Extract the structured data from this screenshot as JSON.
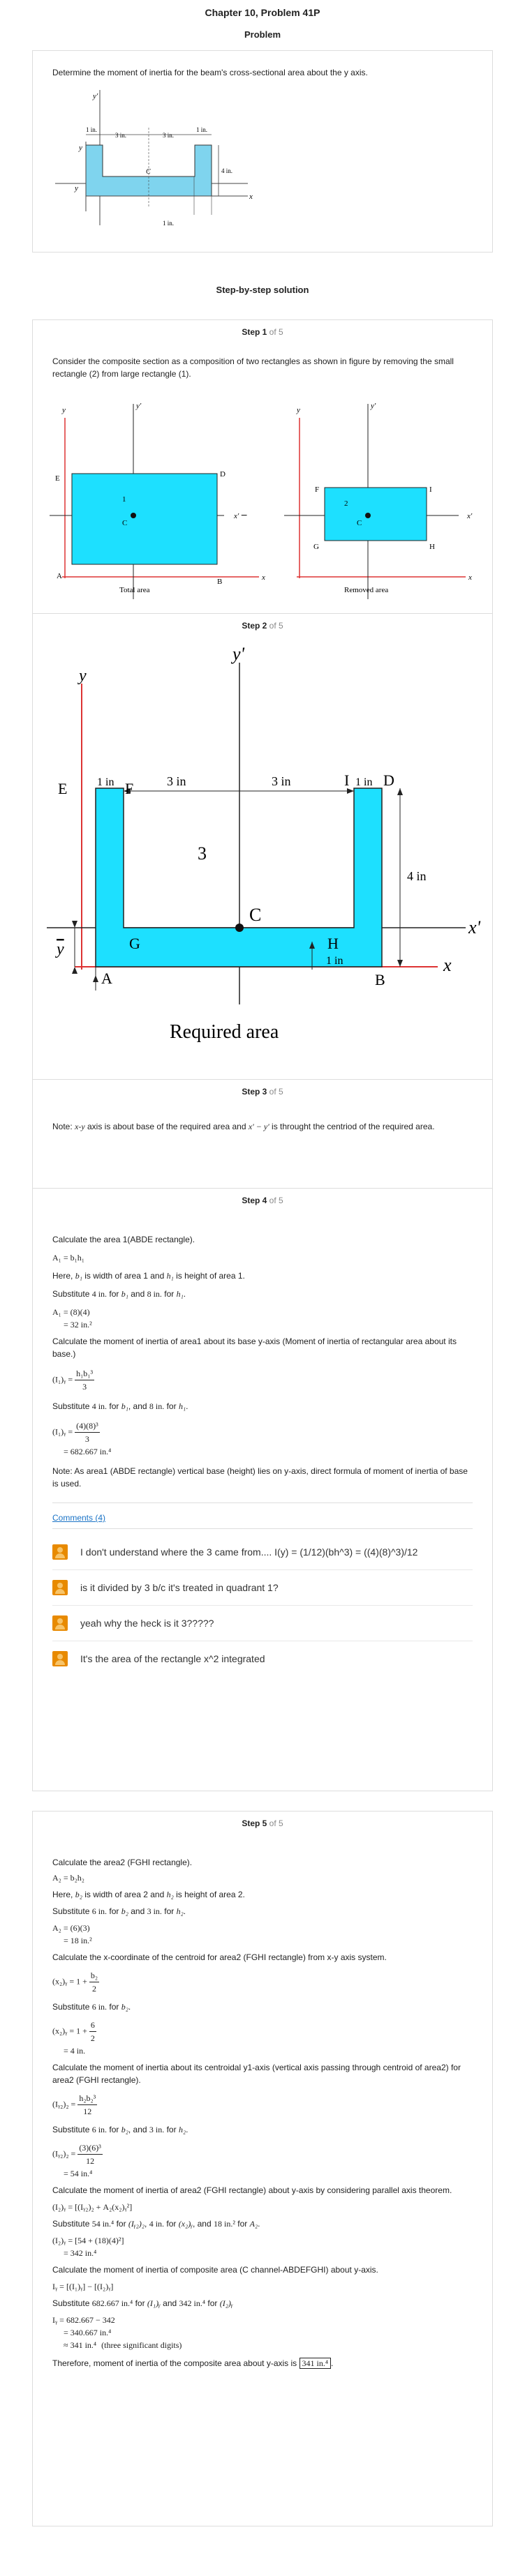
{
  "page_title": "Chapter 10, Problem 41P",
  "problem_heading": "Problem",
  "problem_text": "Determine the moment of inertia for the beam's cross-sectional area about the y axis.",
  "problem_fig": {
    "d1": "1 in.",
    "d2": "3 in.",
    "d3": "3 in.",
    "d4": "1 in.",
    "h": "4 in.",
    "b": "1 in.",
    "c": "C",
    "x": "x",
    "y": "y",
    "yp": "y'",
    "ybar": "y"
  },
  "solution_heading": "Step-by-step solution",
  "steps_total_label": "of 5",
  "step1": {
    "label": "Step 1",
    "text": "Consider the composite section as a composition of two rectangles as shown in figure by removing the small rectangle (2) from large rectangle (1).",
    "fig_left": {
      "E": "E",
      "D": "D",
      "A": "A",
      "B": "B",
      "C": "C",
      "n": "1",
      "y": "y",
      "yp": "y'",
      "x": "x",
      "xp": "x'",
      "caption": "Total area"
    },
    "minus": "−",
    "fig_right": {
      "F": "F",
      "I": "I",
      "G": "G",
      "H": "H",
      "C": "C",
      "n": "2",
      "y": "y",
      "yp": "y'",
      "x": "x",
      "xp": "x'",
      "caption": "Removed area"
    }
  },
  "step2": {
    "label": "Step 2",
    "fig": {
      "yp": "y'",
      "y": "y",
      "E": "E",
      "F": "F",
      "I": "I",
      "D": "D",
      "d1": "1 in",
      "d2": "3 in",
      "d3": "3 in",
      "d4": "1 in",
      "n3": "3",
      "C": "C",
      "xp": "x'",
      "h": "4 in",
      "G": "G",
      "H": "H",
      "ybar": "y",
      "b": "1 in",
      "A": "A",
      "B": "B",
      "x": "x",
      "caption": "Required area"
    }
  },
  "step3": {
    "label": "Step 3",
    "text_a": "Note: ",
    "text_axes": "x-y",
    "text_b": " axis is about base of the required area and ",
    "text_axes2": "x' − y'",
    "text_c": " is throught the centriod of the required area."
  },
  "step4": {
    "label": "Step 4",
    "l1": "Calculate the area 1(ABDE rectangle).",
    "e1": "A₁ = b₁h₁",
    "l2a": "Here, ",
    "l2b1": "b₁",
    "l2c": " is width of area 1 and ",
    "l2b2": "h₁",
    "l2d": " is height of area 1.",
    "l3a": "Substitute ",
    "l3v1": "4 in.",
    "l3b": " for ",
    "l3s1": "b₁",
    "l3c": " and ",
    "l3v2": "8 in.",
    "l3d": " for ",
    "l3s2": "h₁",
    "l3e": ".",
    "e2a": "A₁ = (8)(4)",
    "e2b": "= 32 in.²",
    "l4": "Calculate the moment of inertia of area1 about its base y-axis (Moment of inertia of rectangular area about its base.)",
    "e3lhs": "(I₁)ᵧ =",
    "e3num": "h₁b₁³",
    "e3den": "3",
    "l5a": "Substitute ",
    "l5v1": "4 in.",
    "l5b": " for ",
    "l5s1": "b₁",
    "l5c": ", and ",
    "l5v2": "8 in.",
    "l5d": " for ",
    "l5s2": "h₁",
    "l5e": ".",
    "e4lhs": "(I₁)ᵧ =",
    "e4num": "(4)(8)³",
    "e4den": "3",
    "e4b": "= 682.667 in.⁴",
    "l6": "Note: As area1 (ABDE rectangle) vertical base (height) lies on y-axis, direct formula of moment of inertia of base is used.",
    "comments_label": "Comments (4)",
    "comments": [
      "I don't understand where the 3 came from.... I(y) = (1/12)(bh^3) = ((4)(8)^3)/12",
      "is it divided by 3 b/c it's treated in quadrant 1?",
      "yeah why the heck is it 3?????",
      "It's the area of the rectangle x^2 integrated"
    ]
  },
  "step5": {
    "label": "Step 5",
    "l1": "Calculate the area2 (FGHI rectangle).",
    "e1": "A₂ = b₂h₂",
    "l2a": "Here, ",
    "l2b1": "b₂",
    "l2c": " is width of area 2 and ",
    "l2b2": "h₂",
    "l2d": " is height of area 2.",
    "l3a": "Substitute ",
    "l3v1": "6 in.",
    "l3b": " for ",
    "l3s1": "b₂",
    "l3c": " and ",
    "l3v2": "3 in.",
    "l3d": " for ",
    "l3s2": "h₂",
    "l3e": ".",
    "e2a": "A₂ = (6)(3)",
    "e2b": "= 18 in.²",
    "l4": "Calculate the x-coordinate of the centroid for area2 (FGHI rectangle) from x-y axis system.",
    "e3lhs": "(x₂)ᵧ = 1 +",
    "e3num": "b₂",
    "e3den": "2",
    "l5a": "Substitute ",
    "l5v1": "6 in.",
    "l5b": " for ",
    "l5s1": "b₂",
    "l5e": ".",
    "e4lhs": "(x₂)ᵧ = 1 +",
    "e4num": "6",
    "e4den": "2",
    "e4b": "= 4 in.",
    "l6": "Calculate the moment of inertia about its centroidal y1-axis (vertical axis passing through centroid of area2) for area2 (FGHI rectangle).",
    "e5lhs": "(Iᵧ₂)₂ =",
    "e5num": "h₂b₂³",
    "e5den": "12",
    "l7a": "Substitute ",
    "l7v1": "6 in.",
    "l7b": " for ",
    "l7s1": "b₂",
    "l7c": ", and ",
    "l7v2": "3 in.",
    "l7d": " for ",
    "l7s2": "h₂",
    "l7e": ".",
    "e6lhs": "(Iᵧ₂)₂ =",
    "e6num": "(3)(6)³",
    "e6den": "12",
    "e6b": "= 54 in.⁴",
    "l8": "Calculate the moment of inertia of area2 (FGHI rectangle) about y-axis by considering parallel axis theorem.",
    "e7": "(I₂)ᵧ = [(Iᵧ₂)₂ + A₂(x₂)ᵧ²]",
    "l9a": "Substitute ",
    "l9v1": "54 in.⁴",
    "l9b": " for ",
    "l9s1": "(Iᵧ₂)₂",
    "l9c": ", ",
    "l9v2": "4 in.",
    "l9d": " for ",
    "l9s2": "(x₂)ᵧ",
    "l9e": ", and ",
    "l9v3": "18 in.²",
    "l9f": " for ",
    "l9s3": "A₂",
    "l9g": ".",
    "e8a": "(I₂)ᵧ = [54 + (18)(4)²]",
    "e8b": "= 342 in.⁴",
    "l10": "Calculate the moment of inertia of composite area (C channel-ABDEFGHI) about y-axis.",
    "e9": "Iᵧ = [(I₁)ᵧ] − [(I₂)ᵧ]",
    "l11a": "Substitute ",
    "l11v1": "682.667 in.⁴",
    "l11b": " for ",
    "l11s1": "(I₁)ᵧ",
    "l11c": " and ",
    "l11v2": "342 in.⁴",
    "l11d": " for ",
    "l11s2": "(I₂)ᵧ",
    "e10a": "Iᵧ = 682.667 − 342",
    "e10b": "= 340.667 in.⁴",
    "e10c": "≈ 341 in.⁴",
    "e10c2": "(three significant digits)",
    "l12a": "Therefore, moment of inertia of the composite area about y-axis is ",
    "l12ans": "341 in.⁴",
    "l12b": "."
  }
}
